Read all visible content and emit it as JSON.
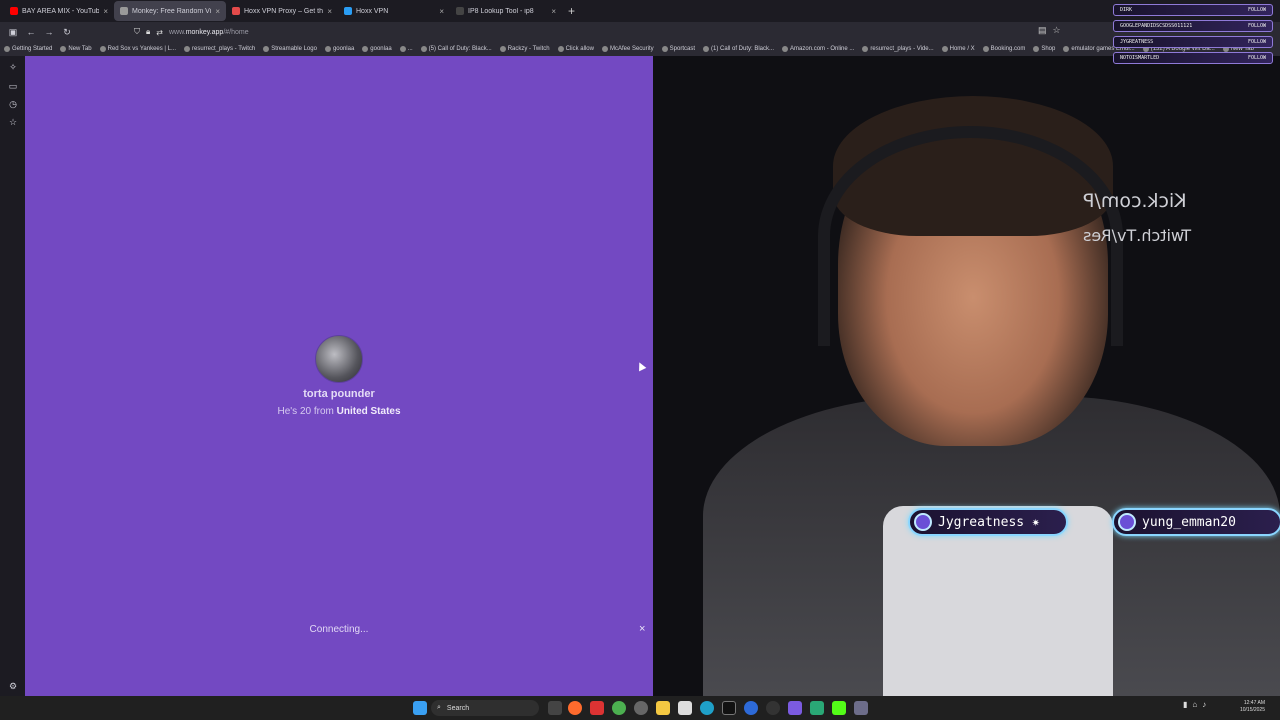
{
  "tabs": [
    {
      "label": "BAY AREA MIX - YouTube",
      "fav_color": "#ff0000",
      "active": false
    },
    {
      "label": "Monkey: Free Random Video C",
      "fav_color": "#9a9a9a",
      "active": true
    },
    {
      "label": "Hoxx VPN Proxy – Get this Exte",
      "fav_color": "#e34a4a",
      "active": false
    },
    {
      "label": "Hoxx VPN",
      "fav_color": "#2a9df4",
      "active": false
    },
    {
      "label": "IP8 Lookup Tool - ip8",
      "fav_color": "#444",
      "active": false
    }
  ],
  "new_tab_symbol": "+",
  "address_bar": {
    "url_prefix": "www.",
    "url_domain": "monkey.app",
    "url_path": "/#/home"
  },
  "bookmarks": [
    "Getting Started",
    "New Tab",
    "Red Sox vs Yankees | L...",
    "resurrect_plays - Twitch",
    "Streamable Logo",
    "goonlaa",
    "goonlaa",
    "...",
    "(5) Call of Duty: Black...",
    "Rackzy - Twitch",
    "Click allow",
    "McAfee Security",
    "Sportcast",
    "(1) Call of Duty: Black...",
    "Amazon.com - Online ...",
    "resurrect_plays - Vide...",
    "Home / X",
    "Booking.com",
    "Shop",
    "emulator games Emul...",
    "(132) A Boogie Wit Da...",
    "New Tab"
  ],
  "profile": {
    "name": "torta pounder",
    "prefix": "He's 20 from ",
    "country": "United States"
  },
  "status": "Connecting...",
  "close_symbol": "×",
  "stream_overlay": {
    "mirrored_line1": "Kick.com/P",
    "mirrored_line2": "Twitch.Tv/Res",
    "followers": [
      {
        "name": "Jygreatness ✷"
      },
      {
        "name": "yung_emman20"
      }
    ],
    "alerts": [
      "DIRK",
      "GOOGLEPANDIDSCSDSS011121",
      "JYGREATNESS",
      "NOTOISMARTLED"
    ],
    "alert_action": "FOLLOW"
  },
  "taskbar": {
    "search_label": "Search",
    "time": "12:47 AM",
    "date": "10/15/2025"
  }
}
